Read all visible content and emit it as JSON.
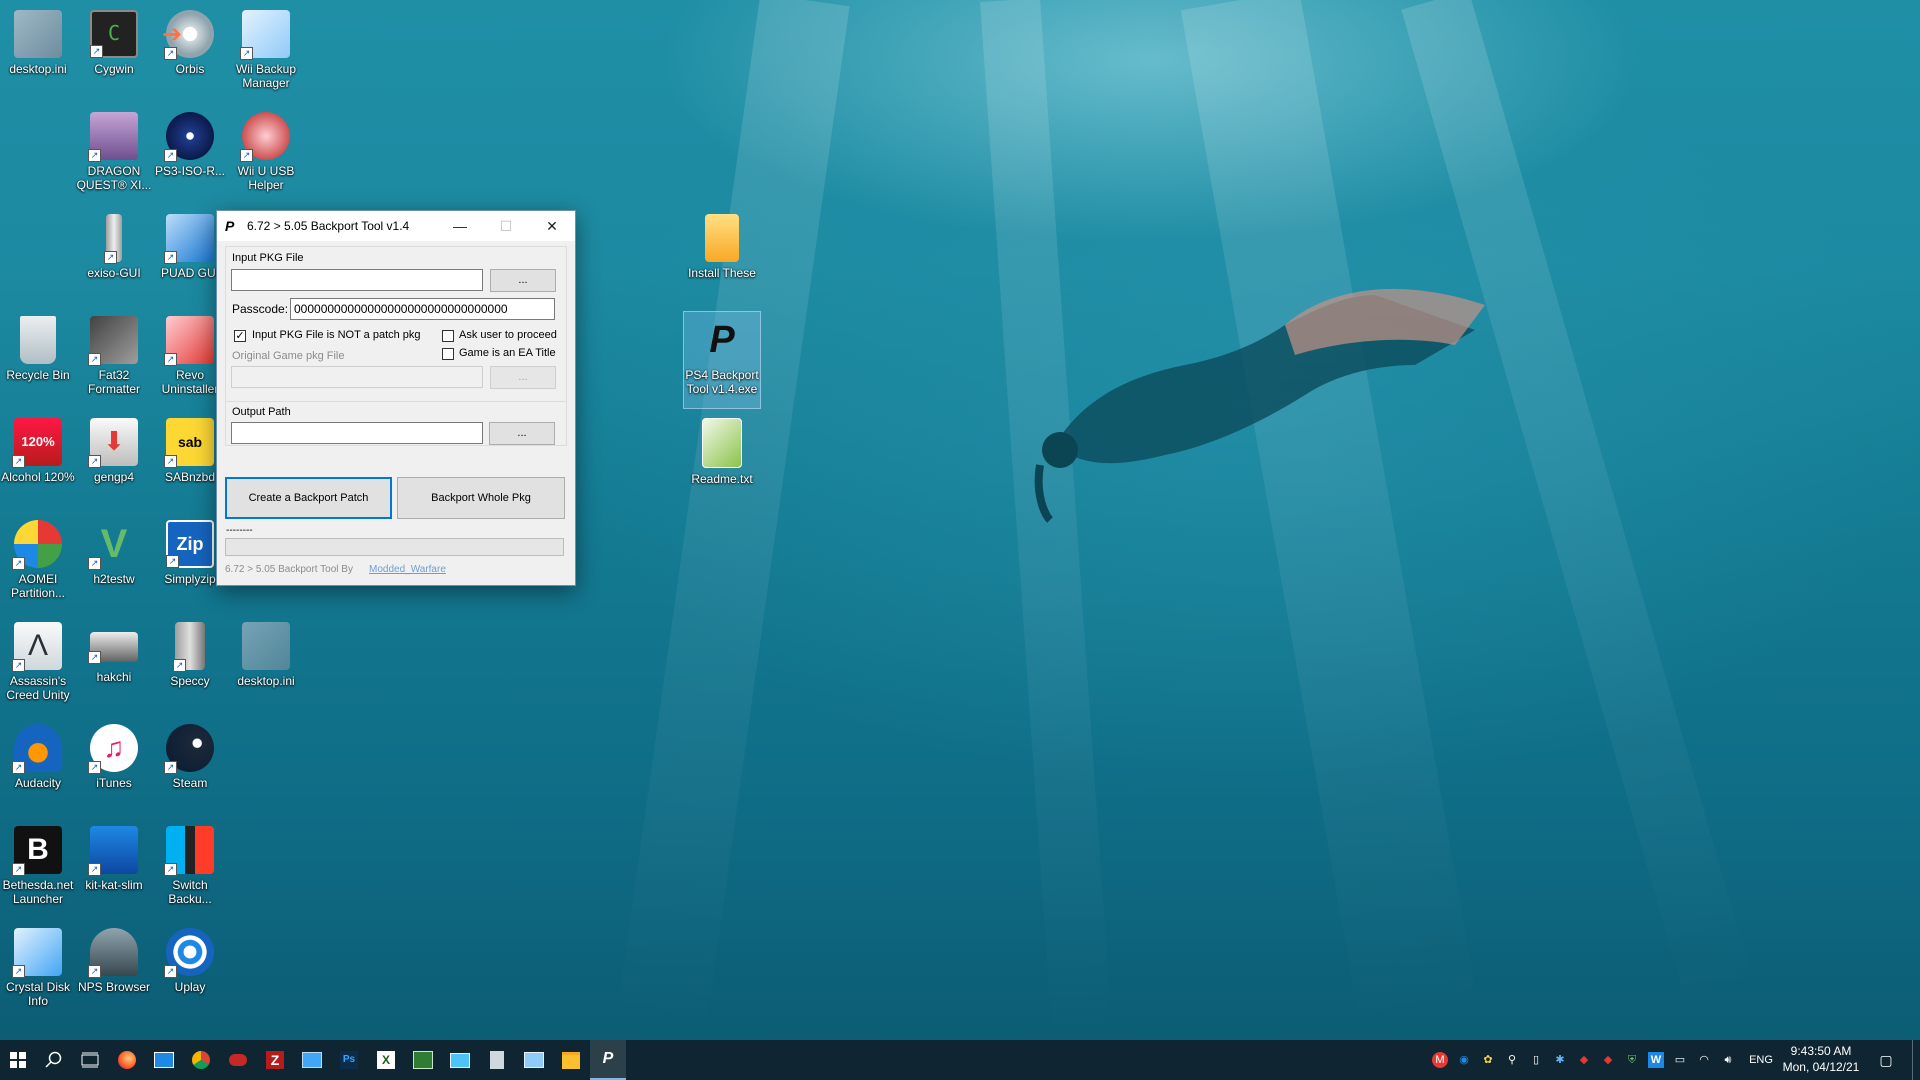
{
  "desktop": {
    "icons": [
      {
        "label": "desktop.ini"
      },
      {
        "label": "Cygwin"
      },
      {
        "label": "Orbis"
      },
      {
        "label": "Wii Backup Manager"
      },
      {
        "label": "DRAGON QUEST® XI..."
      },
      {
        "label": "PS3-ISO-R..."
      },
      {
        "label": "Wii U USB Helper"
      },
      {
        "label": "exiso-GUI"
      },
      {
        "label": "PUAD GUI"
      },
      {
        "label": "Recycle Bin"
      },
      {
        "label": "Fat32 Formatter"
      },
      {
        "label": "Revo Uninstaller"
      },
      {
        "label": "Alcohol 120%"
      },
      {
        "label": "gengp4"
      },
      {
        "label": "SABnzbd"
      },
      {
        "label": "AOMEI Partition..."
      },
      {
        "label": "h2testw"
      },
      {
        "label": "Simplyzip"
      },
      {
        "label": "Assassin's Creed Unity"
      },
      {
        "label": "hakchi"
      },
      {
        "label": "Speccy"
      },
      {
        "label": "desktop.ini"
      },
      {
        "label": "Audacity"
      },
      {
        "label": "iTunes"
      },
      {
        "label": "Steam"
      },
      {
        "label": "Bethesda.net Launcher"
      },
      {
        "label": "kit-kat-slim"
      },
      {
        "label": "Switch Backu..."
      },
      {
        "label": "Crystal Disk Info"
      },
      {
        "label": "NPS Browser"
      },
      {
        "label": "Uplay"
      },
      {
        "label": "Install These"
      },
      {
        "label": "PS4 Backport Tool v1.4.exe"
      },
      {
        "label": "Readme.txt"
      }
    ]
  },
  "window": {
    "title": "6.72 > 5.05 Backport Tool v1.4",
    "minimize": "—",
    "maximize": "☐",
    "close": "✕",
    "input_pkg_label": "Input PKG File",
    "input_pkg_value": "",
    "browse_label": "...",
    "passcode_label": "Passcode:",
    "passcode_value": "00000000000000000000000000000000",
    "not_patch_label": "Input PKG File is NOT a patch pkg",
    "not_patch_checked": true,
    "ask_user_label": "Ask user to proceed",
    "ask_user_checked": false,
    "ea_title_label": "Game is an EA Title",
    "ea_title_checked": false,
    "original_pkg_label": "Original Game pkg File",
    "original_pkg_value": "",
    "output_path_label": "Output Path",
    "output_path_value": "",
    "create_patch_button": "Create a Backport Patch",
    "backport_whole_button": "Backport Whole Pkg",
    "status_text": "--------",
    "progress": 0,
    "footer_text": "6.72 > 5.05 Backport Tool By",
    "footer_link": "Modded_Warfare"
  },
  "taskbar": {
    "time": "9:43:50 AM",
    "date": "Mon, 04/12/21",
    "language": "ENG",
    "apps": [
      "start",
      "search",
      "task-view",
      "firefox",
      "mail",
      "chrome",
      "game",
      "filezilla",
      "remote-desktop",
      "photoshop",
      "excel",
      "terminal",
      "network",
      "calculator",
      "explorer-window",
      "file-explorer",
      "playstation"
    ]
  },
  "colors": {
    "accent": "#0078d7",
    "link": "#6f9fd6",
    "taskbar_bg": "#10222c",
    "water": "#1c8aa1"
  }
}
